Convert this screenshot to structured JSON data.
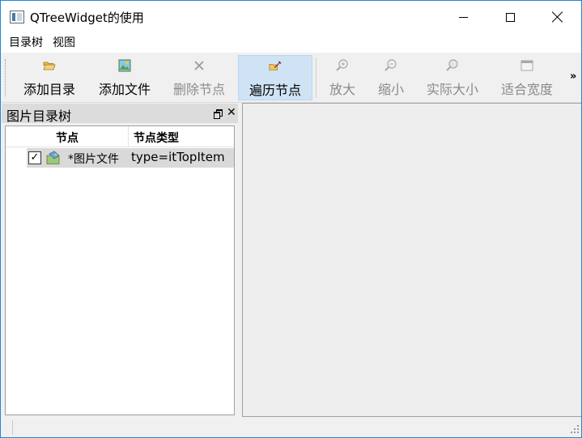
{
  "window": {
    "title": "QTreeWidget的使用"
  },
  "menubar": {
    "items": [
      "目录树",
      "视图"
    ]
  },
  "toolbar": {
    "tools": [
      {
        "label": "添加目录",
        "icon": "open-folder-icon",
        "enabled": true,
        "active": false
      },
      {
        "label": "添加文件",
        "icon": "add-image-icon",
        "enabled": true,
        "active": false
      },
      {
        "label": "删除节点",
        "icon": "delete-icon",
        "enabled": false,
        "active": false
      },
      {
        "label": "遍历节点",
        "icon": "traverse-icon",
        "enabled": true,
        "active": true
      },
      {
        "label": "放大",
        "icon": "zoom-in-icon",
        "enabled": false,
        "active": false
      },
      {
        "label": "缩小",
        "icon": "zoom-out-icon",
        "enabled": false,
        "active": false
      },
      {
        "label": "实际大小",
        "icon": "actual-size-icon",
        "enabled": false,
        "active": false
      },
      {
        "label": "适合宽度",
        "icon": "fit-width-icon",
        "enabled": false,
        "active": false
      }
    ],
    "overflow": "»"
  },
  "dock": {
    "title": "图片目录树",
    "tree": {
      "headers": [
        "节点",
        "节点类型"
      ],
      "rows": [
        {
          "checked": true,
          "check_mark": "✓",
          "label": "*图片文件",
          "type": "type=itTopItem",
          "icon": "image-file-icon"
        }
      ]
    }
  },
  "colors": {
    "window_border": "#1e88d8",
    "active_tool_bg": "#cfe3f5",
    "selected_row": "#d9d9d9"
  }
}
